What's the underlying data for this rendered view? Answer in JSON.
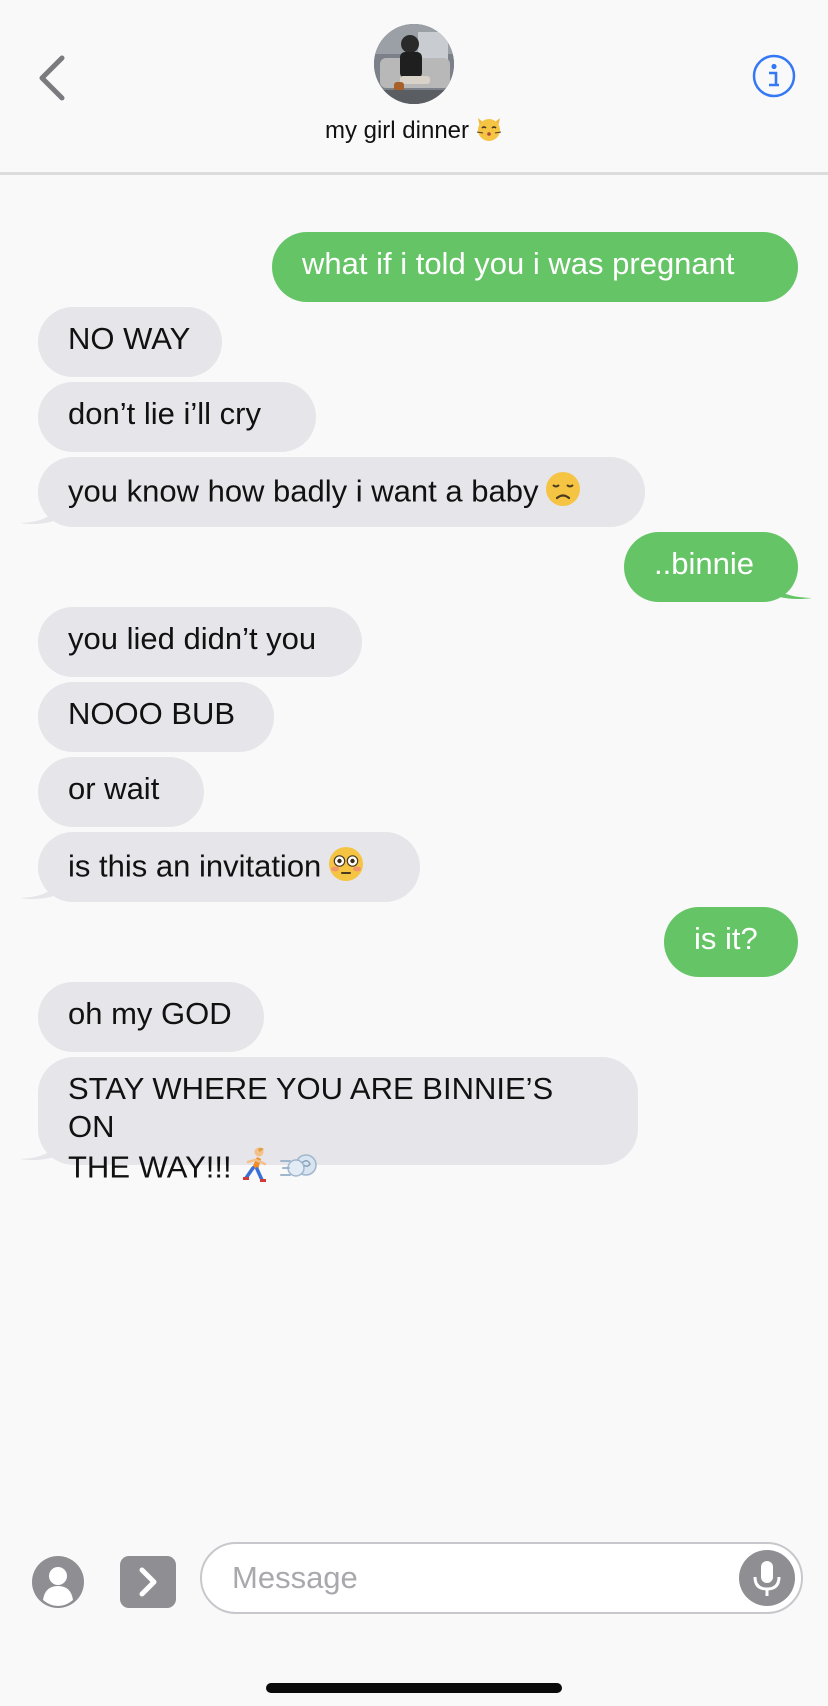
{
  "header": {
    "contact_name": "my girl dinner",
    "contact_emoji": "kissing-cat-emoji"
  },
  "messages": [
    {
      "side": "out",
      "text": "what if i told you i was pregnant"
    },
    {
      "side": "in",
      "text": "NO WAY"
    },
    {
      "side": "in",
      "text": "don’t lie i’ll cry"
    },
    {
      "side": "in",
      "text": "you know how badly i want a baby",
      "emoji": "disappointed-face-emoji"
    },
    {
      "side": "out",
      "text": "..binnie"
    },
    {
      "side": "in",
      "text": "you lied didn’t you"
    },
    {
      "side": "in",
      "text": "NOOO BUB"
    },
    {
      "side": "in",
      "text": "or wait"
    },
    {
      "side": "in",
      "text": "is this an invitation",
      "emoji": "flushed-face-emoji"
    },
    {
      "side": "out",
      "text": "is it?"
    },
    {
      "side": "in",
      "text": "oh my GOD"
    },
    {
      "side": "in",
      "text_line1": "STAY WHERE YOU ARE BINNIE’S ON",
      "text_line2": "THE WAY!!!",
      "emoji": "running-person-emoji, dash-emoji"
    }
  ],
  "composer": {
    "placeholder": "Message"
  },
  "colors": {
    "outgoing_bubble": "#65c466",
    "incoming_bubble": "#e5e5ea",
    "accent": "#3478f6"
  }
}
